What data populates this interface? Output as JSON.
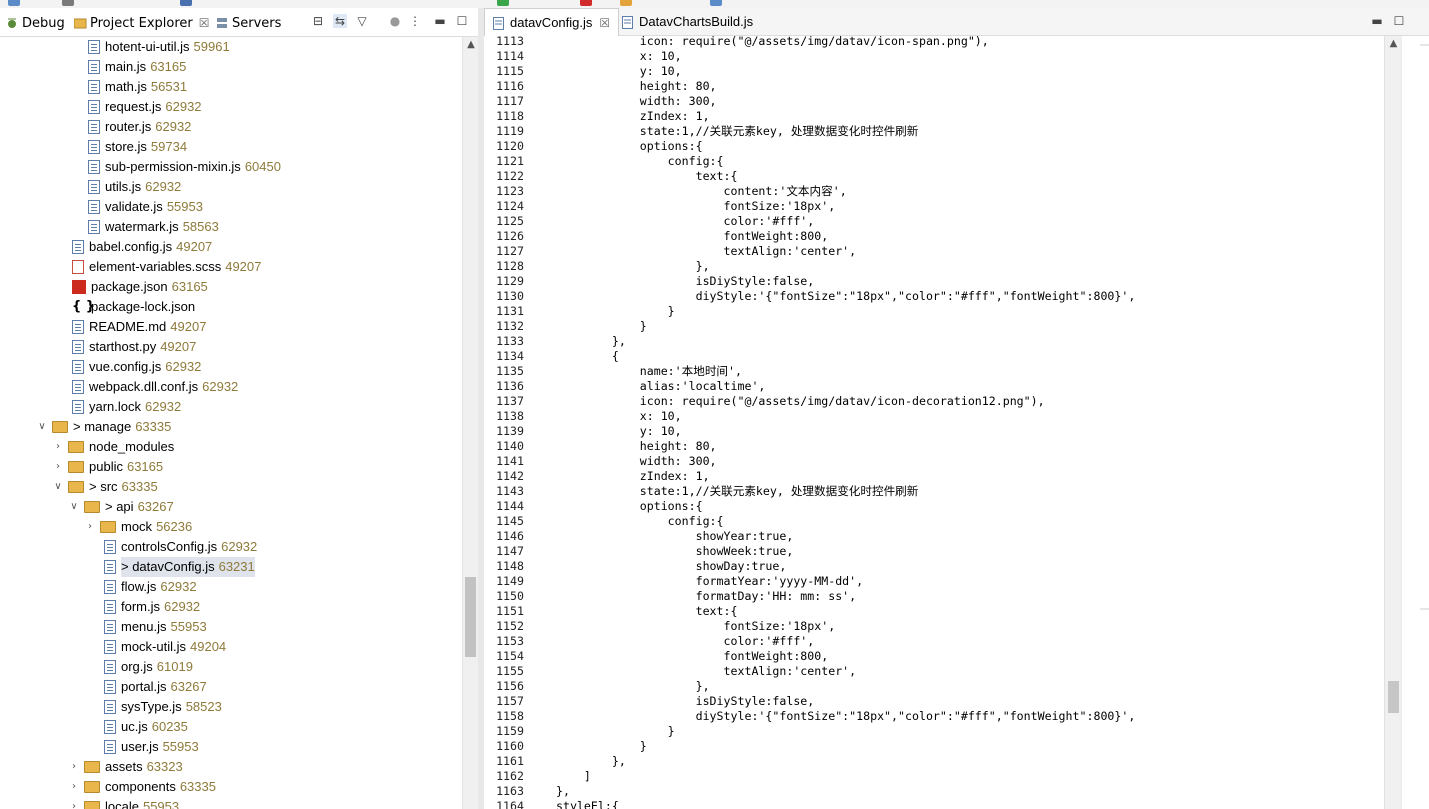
{
  "left_panel": {
    "tabs": [
      {
        "label": "Debug",
        "icon": "debug-icon"
      },
      {
        "label": "Project Explorer",
        "icon": "project-explorer-icon"
      },
      {
        "label": "Servers",
        "icon": "servers-icon"
      }
    ],
    "tree_rows": [
      {
        "name": "hotent-ui-util.js",
        "dec": "59961",
        "indent": 2,
        "type": "js",
        "twist": ""
      },
      {
        "name": "main.js",
        "dec": "63165",
        "indent": 2,
        "type": "js",
        "twist": ""
      },
      {
        "name": "math.js",
        "dec": "56531",
        "indent": 2,
        "type": "js",
        "twist": ""
      },
      {
        "name": "request.js",
        "dec": "62932",
        "indent": 2,
        "type": "js",
        "twist": ""
      },
      {
        "name": "router.js",
        "dec": "62932",
        "indent": 2,
        "type": "js",
        "twist": ""
      },
      {
        "name": "store.js",
        "dec": "59734",
        "indent": 2,
        "type": "js",
        "twist": ""
      },
      {
        "name": "sub-permission-mixin.js",
        "dec": "60450",
        "indent": 2,
        "type": "js",
        "twist": ""
      },
      {
        "name": "utils.js",
        "dec": "62932",
        "indent": 2,
        "type": "js",
        "twist": ""
      },
      {
        "name": "validate.js",
        "dec": "55953",
        "indent": 2,
        "type": "js",
        "twist": ""
      },
      {
        "name": "watermark.js",
        "dec": "58563",
        "indent": 2,
        "type": "js",
        "twist": ""
      },
      {
        "name": "babel.config.js",
        "dec": "49207",
        "indent": 1,
        "type": "js",
        "twist": ""
      },
      {
        "name": "element-variables.scss",
        "dec": "49207",
        "indent": 1,
        "type": "scss",
        "twist": ""
      },
      {
        "name": "package.json",
        "dec": "63165",
        "indent": 1,
        "type": "pkg",
        "twist": ""
      },
      {
        "name": "package-lock.json",
        "dec": "",
        "indent": 1,
        "type": "json",
        "twist": ""
      },
      {
        "name": "README.md",
        "dec": "49207",
        "indent": 1,
        "type": "js",
        "twist": ""
      },
      {
        "name": "starthost.py",
        "dec": "49207",
        "indent": 1,
        "type": "js",
        "twist": ""
      },
      {
        "name": "vue.config.js",
        "dec": "62932",
        "indent": 1,
        "type": "js",
        "twist": ""
      },
      {
        "name": "webpack.dll.conf.js",
        "dec": "62932",
        "indent": 1,
        "type": "js",
        "twist": ""
      },
      {
        "name": "yarn.lock",
        "dec": "62932",
        "indent": 1,
        "type": "js",
        "twist": ""
      },
      {
        "name": "> manage",
        "dec": "63335",
        "indent": 0,
        "type": "folder",
        "twist": "v"
      },
      {
        "name": "node_modules",
        "dec": "",
        "indent": 1,
        "type": "folder",
        "twist": ">"
      },
      {
        "name": "public",
        "dec": "63165",
        "indent": 1,
        "type": "folder",
        "twist": ">"
      },
      {
        "name": "> src",
        "dec": "63335",
        "indent": 1,
        "type": "folder",
        "twist": "v"
      },
      {
        "name": "> api",
        "dec": "63267",
        "indent": 2,
        "type": "folder",
        "twist": "v"
      },
      {
        "name": "mock",
        "dec": "56236",
        "indent": 3,
        "type": "folder",
        "twist": ">"
      },
      {
        "name": "controlsConfig.js",
        "dec": "62932",
        "indent": 3,
        "type": "js",
        "twist": ""
      },
      {
        "name": "> datavConfig.js",
        "dec": "63231",
        "indent": 3,
        "type": "js",
        "twist": "",
        "selected": true
      },
      {
        "name": "flow.js",
        "dec": "62932",
        "indent": 3,
        "type": "js",
        "twist": ""
      },
      {
        "name": "form.js",
        "dec": "62932",
        "indent": 3,
        "type": "js",
        "twist": ""
      },
      {
        "name": "menu.js",
        "dec": "55953",
        "indent": 3,
        "type": "js",
        "twist": ""
      },
      {
        "name": "mock-util.js",
        "dec": "49204",
        "indent": 3,
        "type": "js",
        "twist": ""
      },
      {
        "name": "org.js",
        "dec": "61019",
        "indent": 3,
        "type": "js",
        "twist": ""
      },
      {
        "name": "portal.js",
        "dec": "63267",
        "indent": 3,
        "type": "js",
        "twist": ""
      },
      {
        "name": "sysType.js",
        "dec": "58523",
        "indent": 3,
        "type": "js",
        "twist": ""
      },
      {
        "name": "uc.js",
        "dec": "60235",
        "indent": 3,
        "type": "js",
        "twist": ""
      },
      {
        "name": "user.js",
        "dec": "55953",
        "indent": 3,
        "type": "js",
        "twist": ""
      },
      {
        "name": "assets",
        "dec": "63323",
        "indent": 2,
        "type": "folder",
        "twist": ">"
      },
      {
        "name": "components",
        "dec": "63335",
        "indent": 2,
        "type": "folder",
        "twist": ">"
      },
      {
        "name": "locale",
        "dec": "55953",
        "indent": 2,
        "type": "folder",
        "twist": ">"
      }
    ]
  },
  "editor": {
    "tabs": [
      {
        "label": "datavConfig.js",
        "active": true,
        "close": "☒"
      },
      {
        "label": "DatavChartsBuild.js",
        "active": false,
        "close": ""
      }
    ],
    "lines": [
      {
        "n": "1113",
        "t": "            icon: require(\"@/assets/img/datav/icon-span.png\"),"
      },
      {
        "n": "1114",
        "t": "            x: 10,"
      },
      {
        "n": "1115",
        "t": "            y: 10,"
      },
      {
        "n": "1116",
        "t": "            height: 80,"
      },
      {
        "n": "1117",
        "t": "            width: 300,"
      },
      {
        "n": "1118",
        "t": "            zIndex: 1,"
      },
      {
        "n": "1119",
        "t": "            state:1,//关联元素key, 处理数据变化时控件刷新"
      },
      {
        "n": "1120",
        "t": "            options:{"
      },
      {
        "n": "1121",
        "t": "                config:{"
      },
      {
        "n": "1122",
        "t": "                    text:{"
      },
      {
        "n": "1123",
        "t": "                        content:'文本内容',"
      },
      {
        "n": "1124",
        "t": "                        fontSize:'18px',"
      },
      {
        "n": "1125",
        "t": "                        color:'#fff',"
      },
      {
        "n": "1126",
        "t": "                        fontWeight:800,"
      },
      {
        "n": "1127",
        "t": "                        textAlign:'center',"
      },
      {
        "n": "1128",
        "t": "                    },"
      },
      {
        "n": "1129",
        "t": "                    isDiyStyle:false,"
      },
      {
        "n": "1130",
        "t": "                    diyStyle:'{\"fontSize\":\"18px\",\"color\":\"#fff\",\"fontWeight\":800}',"
      },
      {
        "n": "1131",
        "t": "                }"
      },
      {
        "n": "1132",
        "t": "            }"
      },
      {
        "n": "1133",
        "t": "        },"
      },
      {
        "n": "1134",
        "t": "        {"
      },
      {
        "n": "1135",
        "t": "            name:'本地时间',"
      },
      {
        "n": "1136",
        "t": "            alias:'localtime',"
      },
      {
        "n": "1137",
        "t": "            icon: require(\"@/assets/img/datav/icon-decoration12.png\"),"
      },
      {
        "n": "1138",
        "t": "            x: 10,"
      },
      {
        "n": "1139",
        "t": "            y: 10,"
      },
      {
        "n": "1140",
        "t": "            height: 80,"
      },
      {
        "n": "1141",
        "t": "            width: 300,"
      },
      {
        "n": "1142",
        "t": "            zIndex: 1,"
      },
      {
        "n": "1143",
        "t": "            state:1,//关联元素key, 处理数据变化时控件刷新"
      },
      {
        "n": "1144",
        "t": "            options:{"
      },
      {
        "n": "1145",
        "t": "                config:{"
      },
      {
        "n": "1146",
        "t": "                    showYear:true,"
      },
      {
        "n": "1147",
        "t": "                    showWeek:true,"
      },
      {
        "n": "1148",
        "t": "                    showDay:true,"
      },
      {
        "n": "1149",
        "t": "                    formatYear:'yyyy-MM-dd',"
      },
      {
        "n": "1150",
        "t": "                    formatDay:'HH: mm: ss',"
      },
      {
        "n": "1151",
        "t": "                    text:{"
      },
      {
        "n": "1152",
        "t": "                        fontSize:'18px',"
      },
      {
        "n": "1153",
        "t": "                        color:'#fff',"
      },
      {
        "n": "1154",
        "t": "                        fontWeight:800,"
      },
      {
        "n": "1155",
        "t": "                        textAlign:'center',"
      },
      {
        "n": "1156",
        "t": "                    },"
      },
      {
        "n": "1157",
        "t": "                    isDiyStyle:false,"
      },
      {
        "n": "1158",
        "t": "                    diyStyle:'{\"fontSize\":\"18px\",\"color\":\"#fff\",\"fontWeight\":800}',"
      },
      {
        "n": "1159",
        "t": "                }"
      },
      {
        "n": "1160",
        "t": "            }"
      },
      {
        "n": "1161",
        "t": "        },"
      },
      {
        "n": "1162",
        "t": "    ]"
      },
      {
        "n": "1163",
        "t": "},"
      },
      {
        "n": "1164",
        "t": "styleEl:{"
      }
    ]
  }
}
